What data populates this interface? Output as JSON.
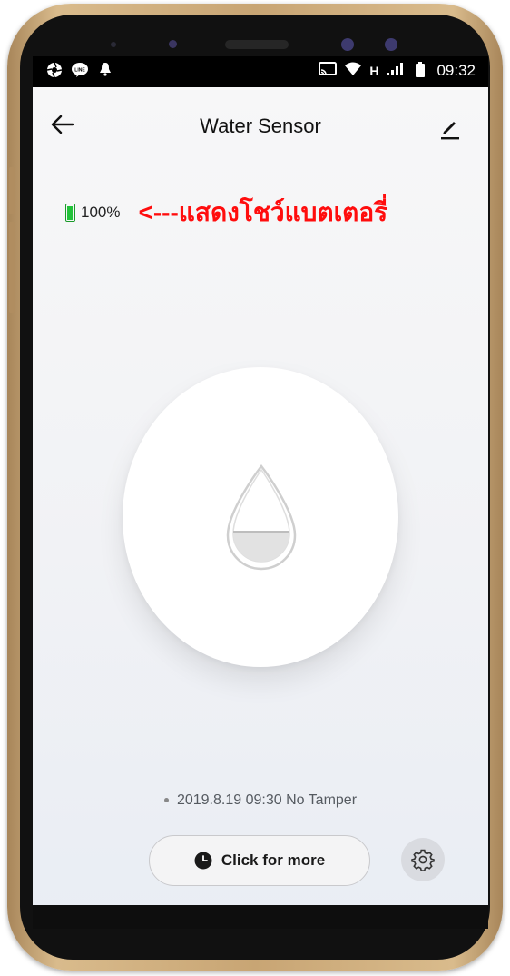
{
  "status_bar": {
    "time": "09:32",
    "network_type": "H"
  },
  "header": {
    "title": "Water Sensor"
  },
  "battery": {
    "level_percent": 100,
    "text": "100%",
    "annotation": "<---แสดงโชว์แบตเตอรี่"
  },
  "sensor": {
    "icon": "water-drop-icon"
  },
  "event": {
    "text": "2019.8.19 09:30 No Tamper"
  },
  "actions": {
    "more_label": "Click for more"
  },
  "colors": {
    "annotation": "#ff0d0d",
    "battery": "#22c33a",
    "frame": "#c8a574"
  }
}
